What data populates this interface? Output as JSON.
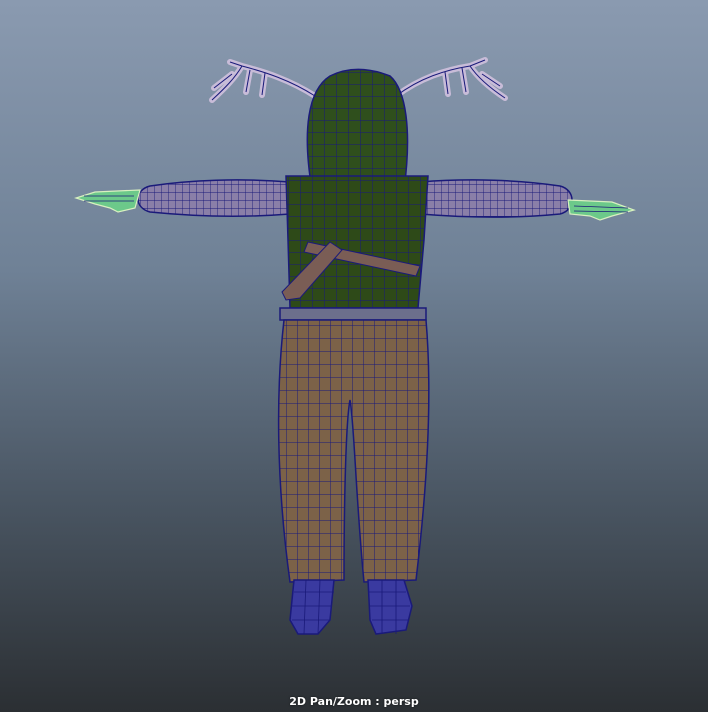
{
  "viewport": {
    "camera_status": "2D Pan/Zoom : persp",
    "background_top": "#8a9ab0",
    "background_bottom": "#2b2f33"
  },
  "model": {
    "wire_color": "#1a1a7a",
    "hood_color": "#2f4f1c",
    "vest_color": "#2e4a18",
    "arm_color": "#8a7fa8",
    "pants_color": "#7c6248",
    "belt_color": "#6c6f8c",
    "strap_color": "#7a5d55",
    "shoe_color": "#3a3aa0",
    "antler_color": "#c8bcd8",
    "hand_color": "#6cc98a",
    "hand_outline": "#d8f0c0"
  }
}
